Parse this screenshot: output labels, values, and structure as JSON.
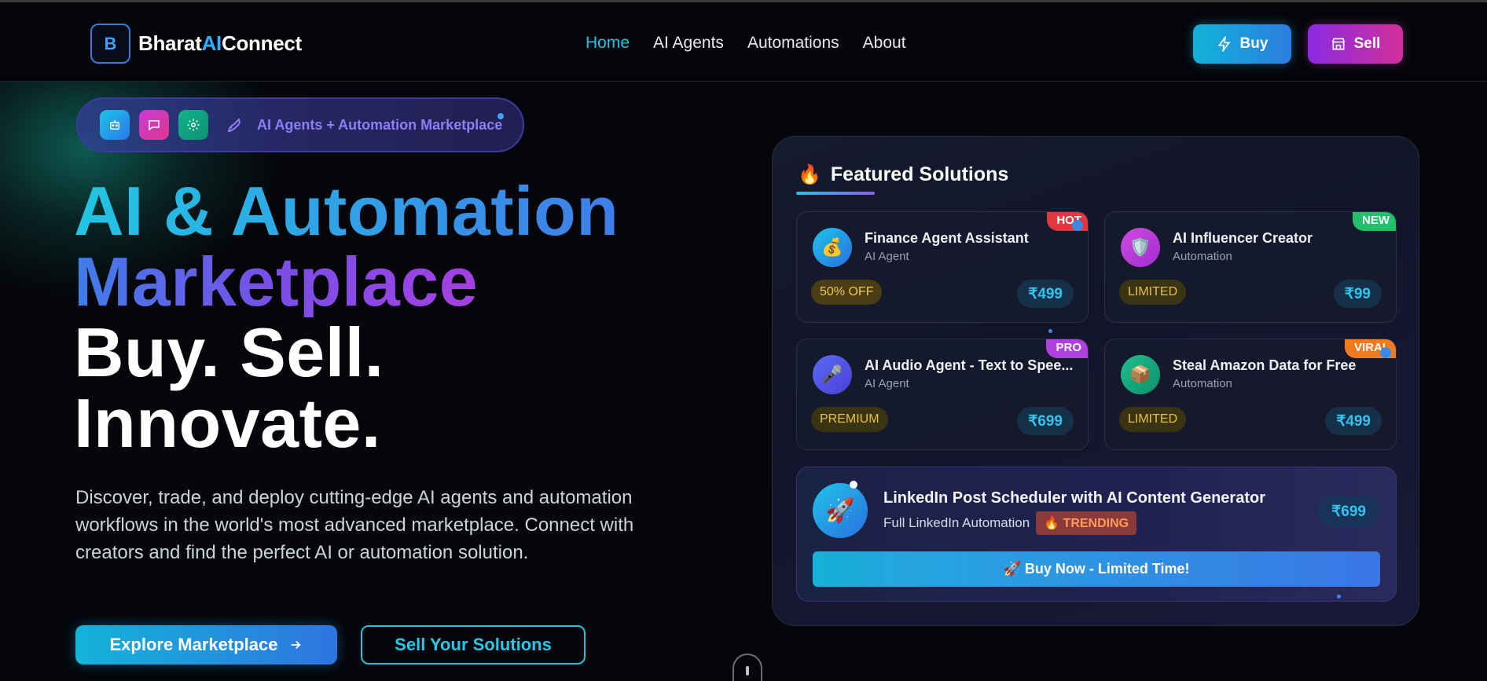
{
  "brand": {
    "logo_letter": "B",
    "name_part1": "Bharat",
    "name_ai": "AI",
    "name_part2": "Connect",
    "accent": "#2fb0ff"
  },
  "nav": {
    "links": [
      {
        "label": "Home",
        "active": true
      },
      {
        "label": "AI Agents",
        "active": false
      },
      {
        "label": "Automations",
        "active": false
      },
      {
        "label": "About",
        "active": false
      }
    ],
    "buy_label": "Buy",
    "sell_label": "Sell"
  },
  "hero": {
    "pill_text": "AI Agents + Automation Marketplace",
    "headline_1": "AI & Automation",
    "headline_2": "Marketplace",
    "headline_3": "Buy. Sell.",
    "headline_4": "Innovate.",
    "description": "Discover, trade, and deploy cutting-edge AI agents and automation workflows in the world's most advanced marketplace. Connect with creators and find the perfect AI or automation solution.",
    "primary_cta": "Explore Marketplace",
    "secondary_cta": "Sell Your Solutions"
  },
  "featured": {
    "title": "Featured Solutions",
    "cards": [
      {
        "name": "Finance Agent Assistant",
        "type": "AI Agent",
        "tag": "50% OFF",
        "price": "₹499",
        "badge": "HOT",
        "icon": "money-bag-icon"
      },
      {
        "name": "AI Influencer Creator",
        "type": "Automation",
        "tag": "LIMITED",
        "price": "₹99",
        "badge": "NEW",
        "icon": "shield-icon"
      },
      {
        "name": "AI Audio Agent - Text to Spee...",
        "type": "AI Agent",
        "tag": "PREMIUM",
        "price": "₹699",
        "badge": "PRO",
        "icon": "microphone-icon"
      },
      {
        "name": "Steal Amazon Data for Free",
        "type": "Automation",
        "tag": "LIMITED",
        "price": "₹499",
        "badge": "VIRAL",
        "icon": "package-icon"
      }
    ],
    "highlight": {
      "title": "LinkedIn Post Scheduler with AI Content Generator",
      "subtitle": "Full LinkedIn Automation",
      "trend": "TRENDING",
      "price": "₹699",
      "button": "🚀 Buy Now - Limited Time!",
      "icon": "rocket-icon"
    }
  }
}
